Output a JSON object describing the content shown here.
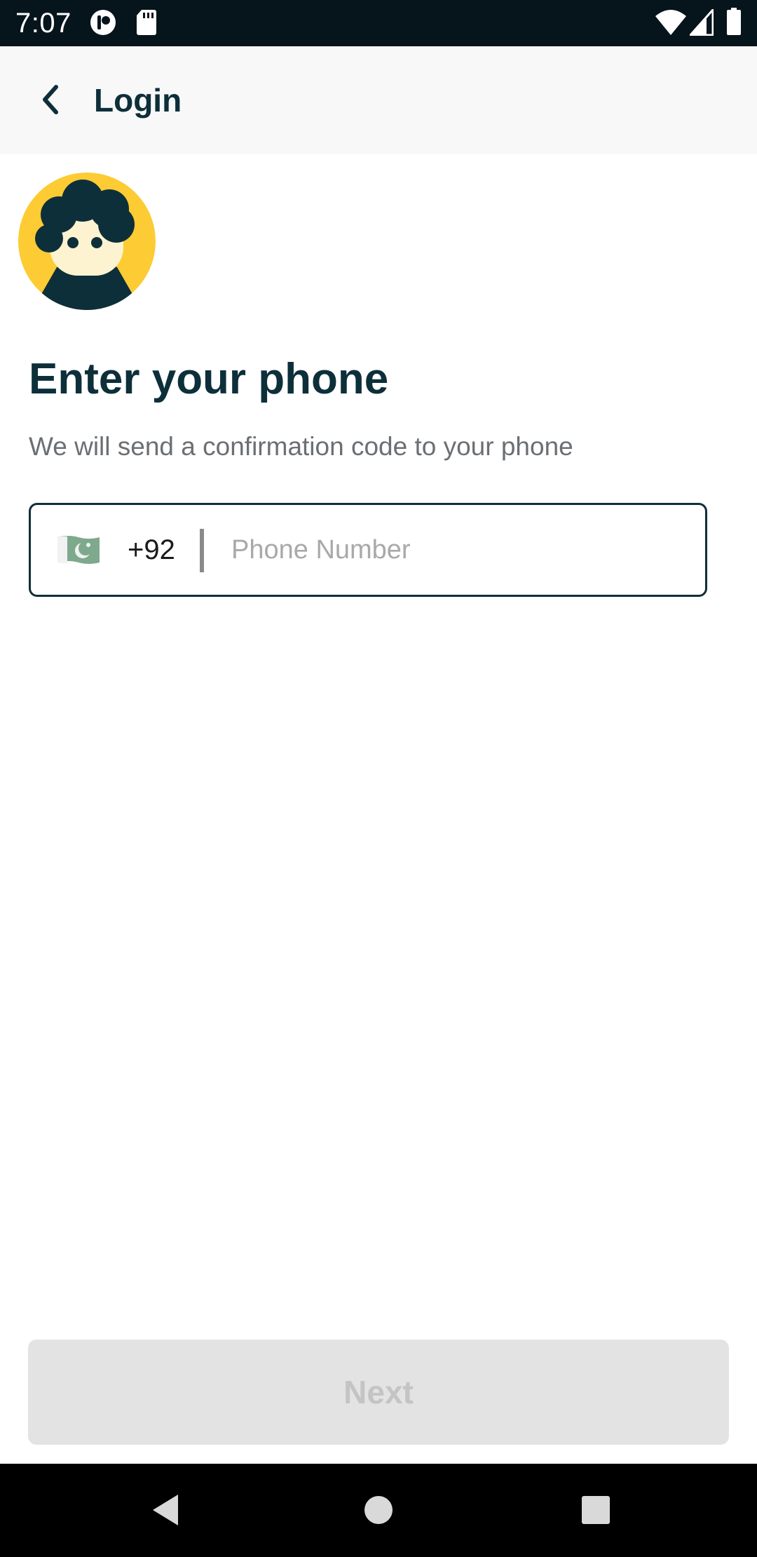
{
  "status_bar": {
    "time": "7:07",
    "icons": [
      "notification-app-icon",
      "sd-card-icon",
      "wifi-icon",
      "cell-signal-icon",
      "battery-icon"
    ]
  },
  "app_bar": {
    "back_icon": "chevron-left-icon",
    "title": "Login"
  },
  "avatar": {
    "icon": "avatar-illustration",
    "colors": {
      "background": "#FDCB33",
      "hair": "#0D2F3A",
      "face": "#FDF3D0"
    }
  },
  "main": {
    "heading": "Enter your phone",
    "subheading": "We will send a confirmation code to your phone",
    "phone_field": {
      "country_flag": "pakistan-flag-icon",
      "country_code": "+92",
      "value": "",
      "placeholder": "Phone Number"
    }
  },
  "next_button": {
    "label": "Next",
    "enabled": false
  },
  "nav_bar": {
    "icons": [
      "back-triangle-icon",
      "home-circle-icon",
      "recents-square-icon"
    ]
  },
  "colors": {
    "primary": "#0D2F3A",
    "accent": "#FDCB33",
    "disabled_bg": "#E3E3E3",
    "disabled_text": "#C4C4C4"
  }
}
